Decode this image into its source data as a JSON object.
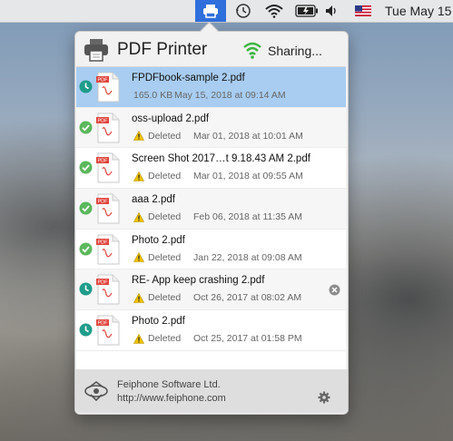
{
  "menubar": {
    "items": [
      "printer-icon",
      "time-machine-icon",
      "wifi-icon",
      "battery-icon",
      "volume-icon",
      "us-flag-icon"
    ],
    "date_time": "Tue May 15",
    "accent": "#2f6fdc"
  },
  "popover": {
    "title": "PDF Printer",
    "sharing_text": "Sharing...",
    "sharing_color": "#3fb43f",
    "files": [
      {
        "name": "FPDFbook-sample 2.pdf",
        "size": "165.0 KB",
        "state": "",
        "date": "May 15, 2018 at 09:14 AM",
        "status": "pending",
        "selected": true
      },
      {
        "name": "oss-upload 2.pdf",
        "size": "",
        "state": "Deleted",
        "date": "Mar 01, 2018 at 10:01 AM",
        "status": "done"
      },
      {
        "name": "Screen Shot 2017…t 9.18.43 AM 2.pdf",
        "size": "",
        "state": "Deleted",
        "date": "Mar 01, 2018 at 09:55 AM",
        "status": "done"
      },
      {
        "name": "aaa 2.pdf",
        "size": "",
        "state": "Deleted",
        "date": "Feb 06, 2018 at 11:35 AM",
        "status": "done"
      },
      {
        "name": "Photo 2.pdf",
        "size": "",
        "state": "Deleted",
        "date": "Jan 22, 2018 at 09:08 AM",
        "status": "done"
      },
      {
        "name": "RE- App keep crashing 2.pdf",
        "size": "",
        "state": "Deleted",
        "date": "Oct 26, 2017 at 08:02 AM",
        "status": "pending",
        "removable": true
      },
      {
        "name": "Photo 2.pdf",
        "size": "",
        "state": "Deleted",
        "date": "Oct 25, 2017 at 01:58 PM",
        "status": "pending"
      }
    ],
    "footer": {
      "company": "Feiphone Software Ltd.",
      "url": "http://www.feiphone.com"
    }
  }
}
